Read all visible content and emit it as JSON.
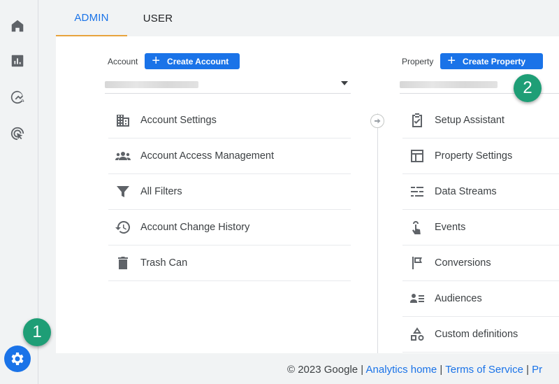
{
  "tabs": {
    "admin": "ADMIN",
    "user": "USER"
  },
  "account": {
    "label": "Account",
    "create_button": "Create Account",
    "items": [
      {
        "label": "Account Settings",
        "icon": "building-icon"
      },
      {
        "label": "Account Access Management",
        "icon": "people-icon"
      },
      {
        "label": "All Filters",
        "icon": "filter-icon"
      },
      {
        "label": "Account Change History",
        "icon": "history-icon"
      },
      {
        "label": "Trash Can",
        "icon": "trash-icon"
      }
    ]
  },
  "property": {
    "label": "Property",
    "create_button": "Create Property",
    "items": [
      {
        "label": "Setup Assistant",
        "icon": "clipboard-check-icon"
      },
      {
        "label": "Property Settings",
        "icon": "layout-icon"
      },
      {
        "label": "Data Streams",
        "icon": "streams-icon"
      },
      {
        "label": "Events",
        "icon": "touch-icon"
      },
      {
        "label": "Conversions",
        "icon": "flag-icon"
      },
      {
        "label": "Audiences",
        "icon": "audience-icon"
      },
      {
        "label": "Custom definitions",
        "icon": "shapes-icon"
      }
    ]
  },
  "badges": {
    "one": "1",
    "two": "2"
  },
  "footer": {
    "copyright": "© 2023 Google",
    "sep": " | ",
    "link1": "Analytics home",
    "link2": "Terms of Service",
    "link3": "Pr"
  },
  "colors": {
    "accent": "#1a73e8",
    "tab_underline": "#e8a33d",
    "badge": "#1e9e76"
  }
}
